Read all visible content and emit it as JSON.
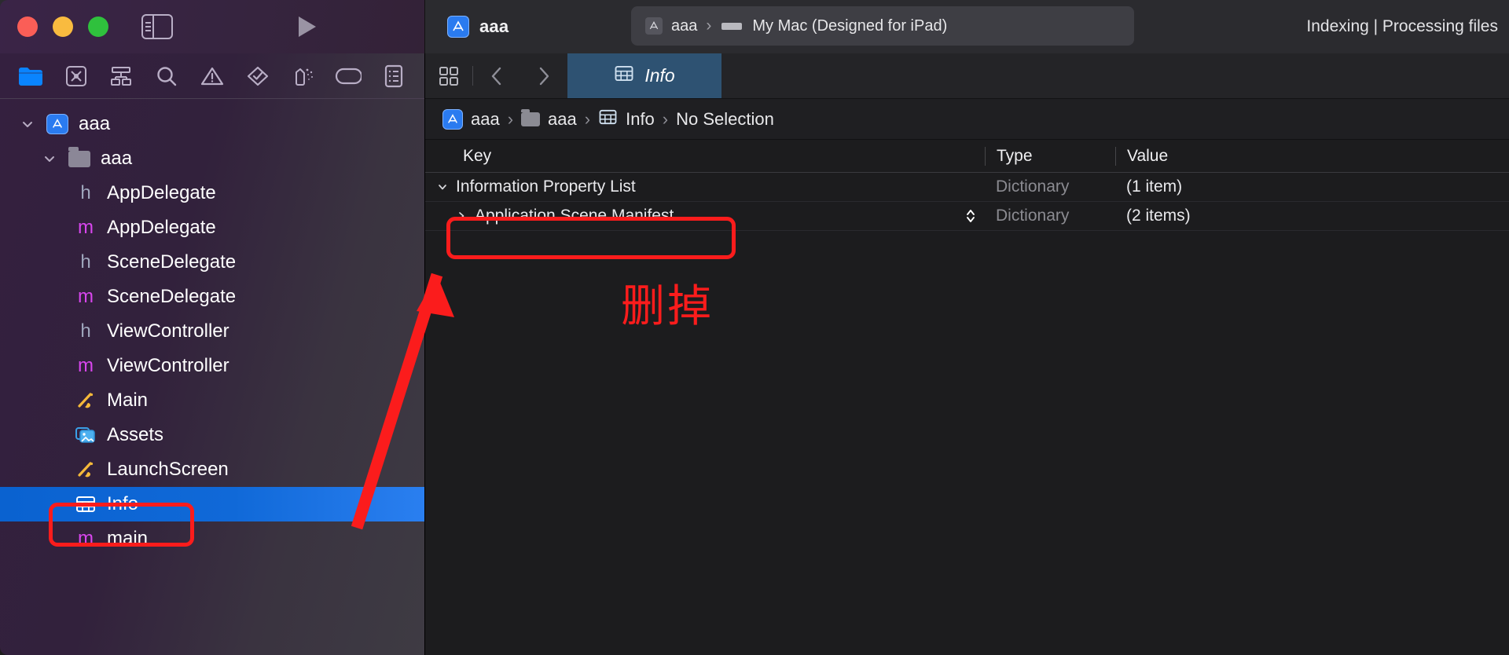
{
  "window": {
    "traffic_lights": [
      "close",
      "minimize",
      "zoom"
    ],
    "sidebar_toggle": "toggle-navigator",
    "run_button": "run"
  },
  "titlebar": {
    "project_name": "aaa",
    "scheme": {
      "target": "aaa",
      "separator": "›",
      "destination": "My Mac (Designed for iPad)"
    },
    "status": "Indexing | Processing files"
  },
  "navigator": {
    "icons": [
      {
        "name": "project-navigator-icon",
        "active": true
      },
      {
        "name": "source-control-navigator-icon",
        "active": false
      },
      {
        "name": "symbol-navigator-icon",
        "active": false
      },
      {
        "name": "find-navigator-icon",
        "active": false
      },
      {
        "name": "issue-navigator-icon",
        "active": false
      },
      {
        "name": "test-navigator-icon",
        "active": false
      },
      {
        "name": "debug-navigator-icon",
        "active": false
      },
      {
        "name": "breakpoint-navigator-icon",
        "active": false
      },
      {
        "name": "report-navigator-icon",
        "active": false
      }
    ],
    "tree": [
      {
        "label": "aaa",
        "icon": "xcode-project-icon",
        "indent": 0,
        "twisty": "open",
        "selected": false
      },
      {
        "label": "aaa",
        "icon": "folder-icon",
        "indent": 1,
        "twisty": "open",
        "selected": false
      },
      {
        "label": "AppDelegate",
        "icon": "h-file-icon",
        "indent": 2,
        "twisty": "none",
        "selected": false
      },
      {
        "label": "AppDelegate",
        "icon": "m-file-icon",
        "indent": 2,
        "twisty": "none",
        "selected": false
      },
      {
        "label": "SceneDelegate",
        "icon": "h-file-icon",
        "indent": 2,
        "twisty": "none",
        "selected": false
      },
      {
        "label": "SceneDelegate",
        "icon": "m-file-icon",
        "indent": 2,
        "twisty": "none",
        "selected": false
      },
      {
        "label": "ViewController",
        "icon": "h-file-icon",
        "indent": 2,
        "twisty": "none",
        "selected": false
      },
      {
        "label": "ViewController",
        "icon": "m-file-icon",
        "indent": 2,
        "twisty": "none",
        "selected": false
      },
      {
        "label": "Main",
        "icon": "storyboard-icon",
        "indent": 2,
        "twisty": "none",
        "selected": false
      },
      {
        "label": "Assets",
        "icon": "assets-catalog-icon",
        "indent": 2,
        "twisty": "none",
        "selected": false
      },
      {
        "label": "LaunchScreen",
        "icon": "storyboard-icon",
        "indent": 2,
        "twisty": "none",
        "selected": false
      },
      {
        "label": "Info",
        "icon": "plist-icon",
        "indent": 2,
        "twisty": "none",
        "selected": true
      },
      {
        "label": "main",
        "icon": "m-file-icon",
        "indent": 2,
        "twisty": "none",
        "selected": false
      }
    ]
  },
  "editor": {
    "tabbar": {
      "grid_icon": "editor-options-icon",
      "back": "‹",
      "forward": "›",
      "tab_label": "Info",
      "tab_icon": "plist-icon"
    },
    "breadcrumb": [
      {
        "label": "aaa",
        "icon": "xcode-project-icon"
      },
      {
        "label": "aaa",
        "icon": "folder-icon"
      },
      {
        "label": "Info",
        "icon": "plist-icon"
      },
      {
        "label": "No Selection",
        "icon": "none"
      }
    ],
    "breadcrumb_separator": "›",
    "plist": {
      "columns": [
        "Key",
        "Type",
        "Value"
      ],
      "rows": [
        {
          "key": "Information Property List",
          "type": "Dictionary",
          "value": "(1 item)",
          "indent": 0,
          "twisty": "open",
          "stepper": false
        },
        {
          "key": "Application Scene Manifest",
          "type": "Dictionary",
          "value": "(2 items)",
          "indent": 1,
          "twisty": "closed",
          "stepper": true
        }
      ]
    }
  },
  "annotations": {
    "color": "#fb1c1c",
    "note_text": "删掉",
    "boxes": [
      {
        "name": "highlight-application-scene-manifest"
      },
      {
        "name": "highlight-info-plist-file"
      }
    ],
    "arrow": {
      "name": "arrow-pointing-to-scene-manifest"
    }
  }
}
